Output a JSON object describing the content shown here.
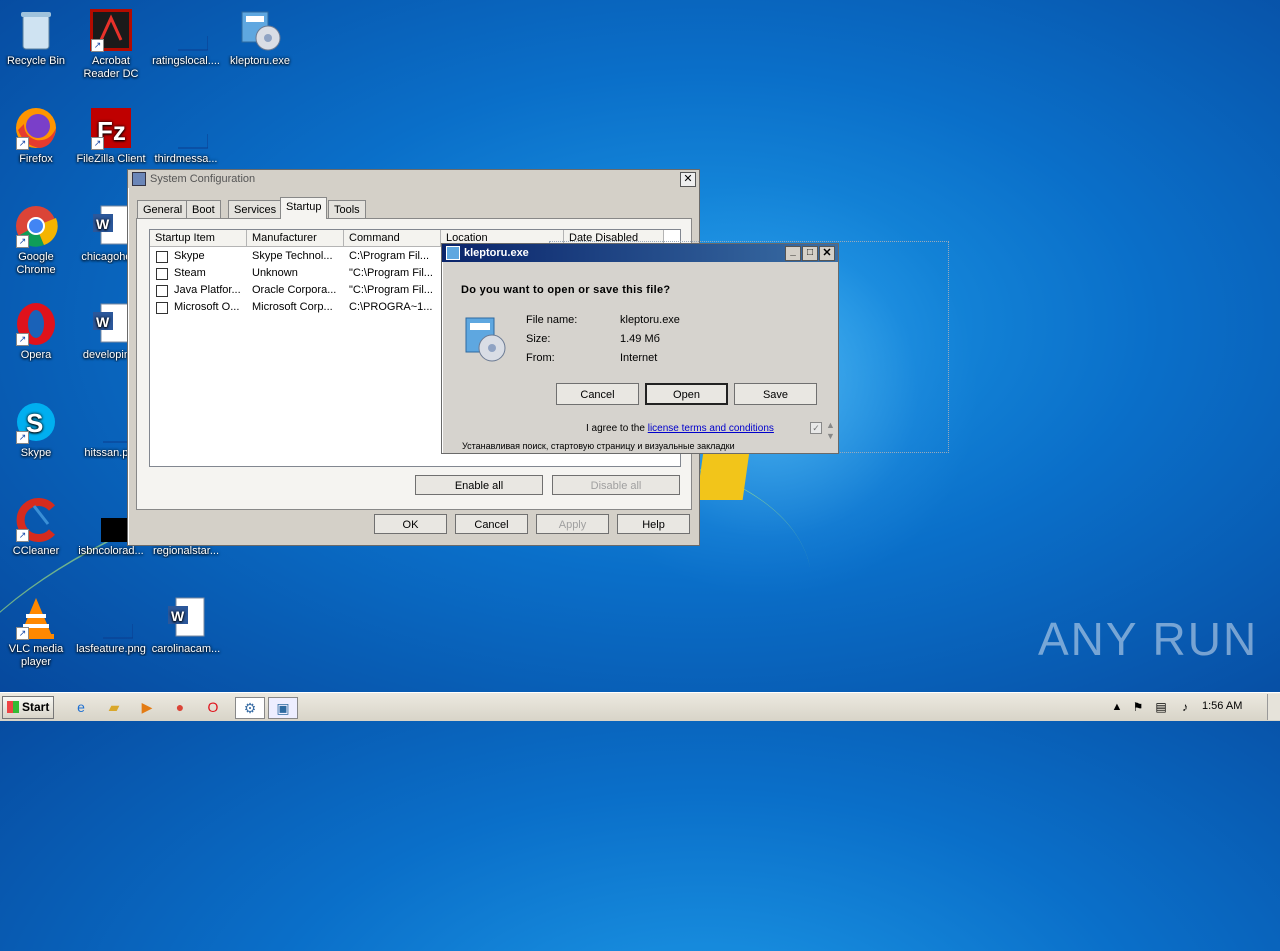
{
  "desktop": {
    "icons": [
      {
        "label": "Recycle Bin"
      },
      {
        "label": "Acrobat Reader DC"
      },
      {
        "label": "ratingslocal...."
      },
      {
        "label": "kleptoru.exe"
      },
      {
        "label": "Firefox"
      },
      {
        "label": "FileZilla Client"
      },
      {
        "label": "thirdmessa..."
      },
      {
        "label": "Google Chrome"
      },
      {
        "label": "chicagoho..."
      },
      {
        "label": "Opera"
      },
      {
        "label": "developin..."
      },
      {
        "label": "Skype"
      },
      {
        "label": "hitssan.p..."
      },
      {
        "label": "CCleaner"
      },
      {
        "label": "isbncolorad..."
      },
      {
        "label": "regionalstar..."
      },
      {
        "label": "VLC media player"
      },
      {
        "label": "lasfeature.png"
      },
      {
        "label": "carolinacam..."
      }
    ]
  },
  "msconfig": {
    "title": "System Configuration",
    "tabs": [
      "General",
      "Boot",
      "Services",
      "Startup",
      "Tools"
    ],
    "columns": [
      "Startup Item",
      "Manufacturer",
      "Command",
      "Location",
      "Date Disabled"
    ],
    "rows": [
      {
        "item": "Skype",
        "manufacturer": "Skype Technol...",
        "command": "C:\\Program Fil..."
      },
      {
        "item": "Steam",
        "manufacturer": "Unknown",
        "command": "\"C:\\Program Fil..."
      },
      {
        "item": "Java Platfor...",
        "manufacturer": "Oracle Corpora...",
        "command": "\"C:\\Program Fil..."
      },
      {
        "item": "Microsoft O...",
        "manufacturer": "Microsoft Corp...",
        "command": "C:\\PROGRA~1..."
      }
    ],
    "enable_all": "Enable all",
    "disable_all": "Disable all",
    "ok": "OK",
    "cancel": "Cancel",
    "apply": "Apply",
    "help": "Help"
  },
  "download_dialog": {
    "title": "kleptoru.exe",
    "question": "Do you want to open or save this file?",
    "file_name_label": "File name:",
    "file_name_value": "kleptoru.exe",
    "size_label": "Size:",
    "size_value": "1.49 Mб",
    "from_label": "From:",
    "from_value": "Internet",
    "cancel": "Cancel",
    "open": "Open",
    "save": "Save",
    "agree_prefix": "I agree to the",
    "agree_link": "license terms and conditions",
    "footer_text": "Устанавливая поиск, стартовую страницу и визуальные закладки"
  },
  "taskbar": {
    "start_label": "Start",
    "clock": "1:56 AM"
  },
  "watermark": "ANY RUN"
}
